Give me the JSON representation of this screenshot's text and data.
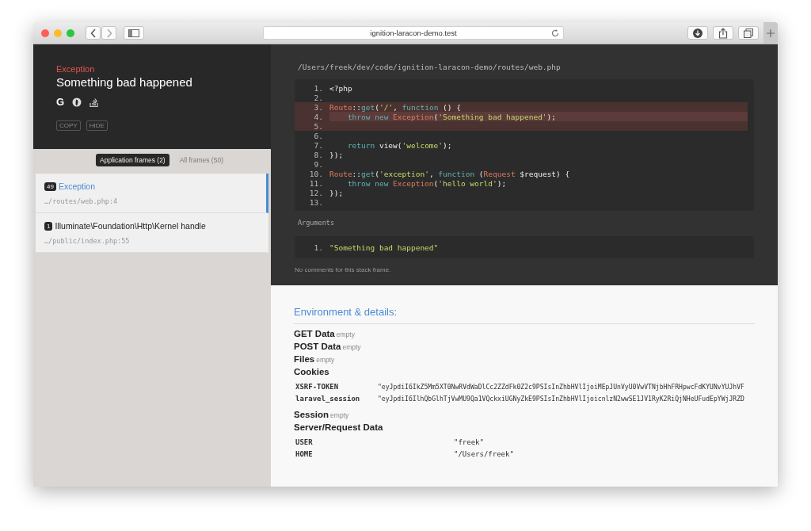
{
  "browser": {
    "url": "ignition-laracon-demo.test"
  },
  "exception": {
    "class": "Exception",
    "message": "Something bad happened",
    "search_icons": [
      {
        "kind": "letter",
        "text": "G"
      },
      {
        "kind": "duck"
      },
      {
        "kind": "stack"
      }
    ],
    "buttons": [
      "COPY",
      "HIDE"
    ]
  },
  "frame_tabs": [
    {
      "label": "Application frames (2)",
      "selected": true
    },
    {
      "label": "All frames (50)",
      "selected": false
    }
  ],
  "frames": [
    {
      "count": "49",
      "title": "Exception",
      "path": "…/routes/web.php:4",
      "selected": true
    },
    {
      "count": "1",
      "title": "Illuminate\\Foundation\\Http\\Kernel handle",
      "path": "…/public/index.php:55",
      "selected": false
    }
  ],
  "file_path": "/Users/freek/dev/code/ignition-laracon-demo/routes/web.php",
  "code": [
    {
      "number": "1.",
      "highlighted": false,
      "selected": false,
      "tokens": [
        {
          "kind": "plain",
          "text": "<?php"
        }
      ]
    },
    {
      "number": "2.",
      "highlighted": false,
      "selected": false
    },
    {
      "number": "3.",
      "highlighted": true,
      "selected": false,
      "tokens": [
        {
          "kind": "class",
          "text": "Route"
        },
        {
          "kind": "plain",
          "text": "::"
        },
        {
          "kind": "keyword",
          "text": "get"
        },
        {
          "kind": "plain",
          "text": "("
        },
        {
          "kind": "string",
          "text": "'/'"
        },
        {
          "kind": "plain",
          "text": ", "
        },
        {
          "kind": "keyword",
          "text": "function"
        },
        {
          "kind": "plain",
          "text": " () {"
        }
      ]
    },
    {
      "number": "4.",
      "highlighted": true,
      "selected": true,
      "indent": true,
      "tokens": [
        {
          "kind": "keyword",
          "text": "throw new "
        },
        {
          "kind": "class",
          "text": "Exception"
        },
        {
          "kind": "plain",
          "text": "("
        },
        {
          "kind": "string",
          "text": "'Something bad happened'"
        },
        {
          "kind": "plain",
          "text": ");"
        }
      ]
    },
    {
      "number": "5.",
      "highlighted": true,
      "selected": false
    },
    {
      "number": "6.",
      "highlighted": false,
      "selected": false
    },
    {
      "number": "7.",
      "highlighted": false,
      "selected": false,
      "indent": true,
      "tokens": [
        {
          "kind": "keyword",
          "text": "return"
        },
        {
          "kind": "plain",
          "text": " view("
        },
        {
          "kind": "string",
          "text": "'welcome'"
        },
        {
          "kind": "plain",
          "text": ");"
        }
      ]
    },
    {
      "number": "8.",
      "highlighted": false,
      "selected": false,
      "tokens": [
        {
          "kind": "plain",
          "text": "});"
        }
      ]
    },
    {
      "number": "9.",
      "highlighted": false,
      "selected": false
    },
    {
      "number": "10.",
      "highlighted": false,
      "selected": false,
      "tokens": [
        {
          "kind": "class",
          "text": "Route"
        },
        {
          "kind": "plain",
          "text": "::"
        },
        {
          "kind": "keyword",
          "text": "get"
        },
        {
          "kind": "plain",
          "text": "("
        },
        {
          "kind": "string",
          "text": "'exception'"
        },
        {
          "kind": "plain",
          "text": ", "
        },
        {
          "kind": "keyword",
          "text": "function"
        },
        {
          "kind": "plain",
          "text": " ("
        },
        {
          "kind": "class",
          "text": "Request"
        },
        {
          "kind": "plain",
          "text": " $request) {"
        }
      ]
    },
    {
      "number": "11.",
      "highlighted": false,
      "selected": false,
      "indent": true,
      "tokens": [
        {
          "kind": "keyword",
          "text": "throw new "
        },
        {
          "kind": "class",
          "text": "Exception"
        },
        {
          "kind": "plain",
          "text": "("
        },
        {
          "kind": "string",
          "text": "'hello world'"
        },
        {
          "kind": "plain",
          "text": ");"
        }
      ]
    },
    {
      "number": "12.",
      "highlighted": false,
      "selected": false,
      "tokens": [
        {
          "kind": "plain",
          "text": "});"
        }
      ]
    },
    {
      "number": "13.",
      "highlighted": false,
      "selected": false
    }
  ],
  "arguments": {
    "title": "Arguments",
    "items": [
      {
        "number": "1.",
        "value": "\"Something bad happened\""
      }
    ]
  },
  "comments": "No comments for this stack frame.",
  "environment": {
    "title": "Environment & details:",
    "sections": [
      {
        "kind": "empty",
        "name": "GET Data",
        "note": "empty"
      },
      {
        "kind": "empty",
        "name": "POST Data",
        "note": "empty"
      },
      {
        "kind": "empty",
        "name": "Files",
        "note": "empty"
      },
      {
        "kind": "table",
        "name": "Cookies",
        "rows": [
          {
            "key": "XSRF-TOKEN",
            "value": "\"eyJpdiI6IkZ5Mm5XT0NwRVdWaDlCc2ZZdFk0Z2c9PSIsInZhbHVlIjoiMEpJUnVyU0VwVTNjbHhFRHpwcFdKYUNvYUJhVF"
          },
          {
            "key": "laravel_session",
            "value": "\"eyJpdiI6IlhQbGlhTjVwMU9Qa1VQckxiUGNyZkE9PSIsInZhbHVlIjoicnlzN2wwSE1JV1RyK2RiQjNHeUFudEpYWjJRZD"
          }
        ]
      },
      {
        "kind": "empty",
        "name": "Session",
        "note": "empty"
      },
      {
        "kind": "wide",
        "name": "Server/Request Data",
        "rows": [
          {
            "key": "USER",
            "value": "\"freek\""
          },
          {
            "key": "HOME",
            "value": "\"/Users/freek\""
          }
        ]
      }
    ]
  }
}
